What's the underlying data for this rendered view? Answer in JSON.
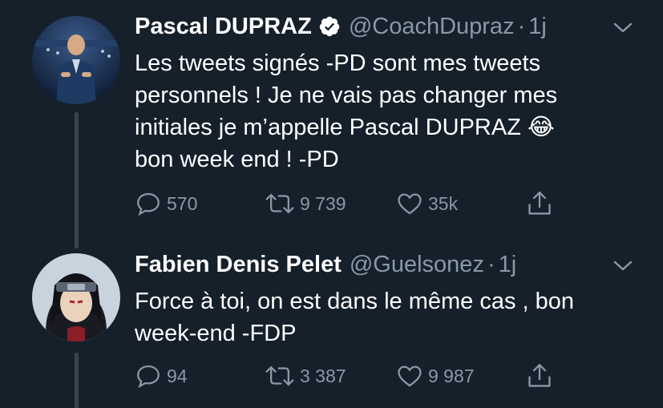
{
  "tweets": [
    {
      "name": "Pascal DUPRAZ",
      "verified": true,
      "handle": "@CoachDupraz",
      "separator": "·",
      "time": "1j",
      "text_lines": [
        "Les tweets signés -PD sont mes tweets",
        "personnels ! Je ne vais pas changer mes",
        "initiales je m’appelle Pascal DUPRAZ 😂",
        "bon week end ! -PD"
      ],
      "stats": {
        "replies": "570",
        "retweets": "9 739",
        "likes": "35k"
      }
    },
    {
      "name": "Fabien Denis Pelet",
      "verified": false,
      "handle": "@Guelsonez",
      "separator": "·",
      "time": "1j",
      "text_lines": [
        "Force à toi, on est dans le même cas , bon",
        "week-end -FDP"
      ],
      "stats": {
        "replies": "94",
        "retweets": "3 387",
        "likes": "9 987"
      }
    }
  ],
  "colors": {
    "background": "#15202b",
    "text": "#ffffff",
    "secondary": "#8899a6",
    "thread_line": "#38444d"
  },
  "icons": [
    "verified-badge-icon",
    "chevron-down-icon",
    "reply-icon",
    "retweet-icon",
    "like-icon",
    "share-icon"
  ]
}
